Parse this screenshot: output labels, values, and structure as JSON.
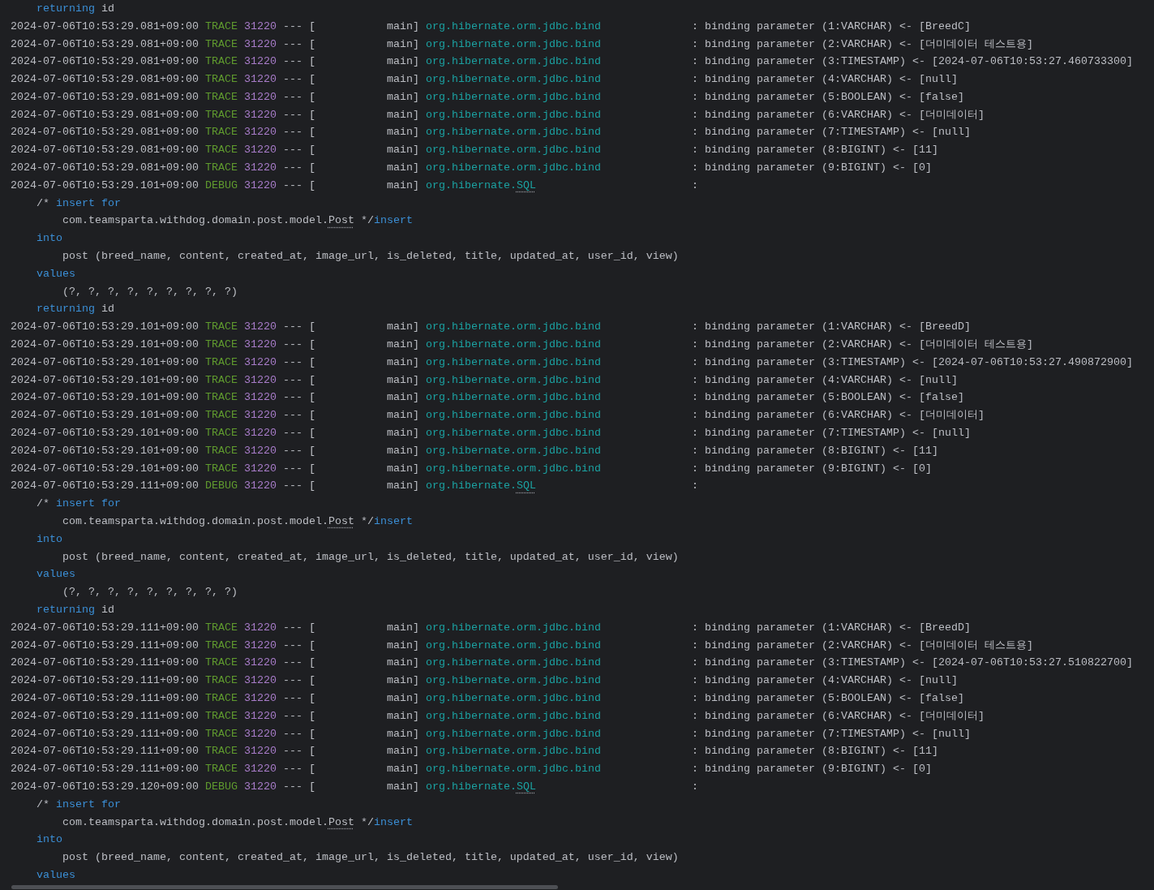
{
  "console": {
    "lines": [
      {
        "kind": "sql",
        "clauses": [
          {
            "segments": [
              {
                "text": "returning",
                "kind": "keyword"
              },
              {
                "text": " id",
                "kind": "plain"
              }
            ]
          }
        ]
      },
      {
        "kind": "log",
        "timestamp": "2024-07-06T10:53:29.081+09:00",
        "level": "TRACE",
        "pid": "31220",
        "separator": "---",
        "bracket": "[",
        "thread": "main]",
        "logger": [
          {
            "text": "org.hibernate.orm.jdbc.bind",
            "marked": false
          }
        ],
        "colon": ":",
        "message": "binding parameter (1:VARCHAR) <- [BreedC]"
      },
      {
        "kind": "log",
        "timestamp": "2024-07-06T10:53:29.081+09:00",
        "level": "TRACE",
        "pid": "31220",
        "separator": "---",
        "bracket": "[",
        "thread": "main]",
        "logger": [
          {
            "text": "org.hibernate.orm.jdbc.bind",
            "marked": false
          }
        ],
        "colon": ":",
        "message": "binding parameter (2:VARCHAR) <- [더미데이터 테스트용]"
      },
      {
        "kind": "log",
        "timestamp": "2024-07-06T10:53:29.081+09:00",
        "level": "TRACE",
        "pid": "31220",
        "separator": "---",
        "bracket": "[",
        "thread": "main]",
        "logger": [
          {
            "text": "org.hibernate.orm.jdbc.bind",
            "marked": false
          }
        ],
        "colon": ":",
        "message": "binding parameter (3:TIMESTAMP) <- [2024-07-06T10:53:27.460733300]"
      },
      {
        "kind": "log",
        "timestamp": "2024-07-06T10:53:29.081+09:00",
        "level": "TRACE",
        "pid": "31220",
        "separator": "---",
        "bracket": "[",
        "thread": "main]",
        "logger": [
          {
            "text": "org.hibernate.orm.jdbc.bind",
            "marked": false
          }
        ],
        "colon": ":",
        "message": "binding parameter (4:VARCHAR) <- [null]"
      },
      {
        "kind": "log",
        "timestamp": "2024-07-06T10:53:29.081+09:00",
        "level": "TRACE",
        "pid": "31220",
        "separator": "---",
        "bracket": "[",
        "thread": "main]",
        "logger": [
          {
            "text": "org.hibernate.orm.jdbc.bind",
            "marked": false
          }
        ],
        "colon": ":",
        "message": "binding parameter (5:BOOLEAN) <- [false]"
      },
      {
        "kind": "log",
        "timestamp": "2024-07-06T10:53:29.081+09:00",
        "level": "TRACE",
        "pid": "31220",
        "separator": "---",
        "bracket": "[",
        "thread": "main]",
        "logger": [
          {
            "text": "org.hibernate.orm.jdbc.bind",
            "marked": false
          }
        ],
        "colon": ":",
        "message": "binding parameter (6:VARCHAR) <- [더미데이터]"
      },
      {
        "kind": "log",
        "timestamp": "2024-07-06T10:53:29.081+09:00",
        "level": "TRACE",
        "pid": "31220",
        "separator": "---",
        "bracket": "[",
        "thread": "main]",
        "logger": [
          {
            "text": "org.hibernate.orm.jdbc.bind",
            "marked": false
          }
        ],
        "colon": ":",
        "message": "binding parameter (7:TIMESTAMP) <- [null]"
      },
      {
        "kind": "log",
        "timestamp": "2024-07-06T10:53:29.081+09:00",
        "level": "TRACE",
        "pid": "31220",
        "separator": "---",
        "bracket": "[",
        "thread": "main]",
        "logger": [
          {
            "text": "org.hibernate.orm.jdbc.bind",
            "marked": false
          }
        ],
        "colon": ":",
        "message": "binding parameter (8:BIGINT) <- [11]"
      },
      {
        "kind": "log",
        "timestamp": "2024-07-06T10:53:29.081+09:00",
        "level": "TRACE",
        "pid": "31220",
        "separator": "---",
        "bracket": "[",
        "thread": "main]",
        "logger": [
          {
            "text": "org.hibernate.orm.jdbc.bind",
            "marked": false
          }
        ],
        "colon": ":",
        "message": "binding parameter (9:BIGINT) <- [0]"
      },
      {
        "kind": "log",
        "timestamp": "2024-07-06T10:53:29.101+09:00",
        "level": "DEBUG",
        "pid": "31220",
        "separator": "---",
        "bracket": "[",
        "thread": "main]",
        "logger": [
          {
            "text": "org.hibernate.",
            "marked": false
          },
          {
            "text": "SQL",
            "marked": true
          }
        ],
        "colon": ":"
      },
      {
        "kind": "sql",
        "clauses": [
          {
            "segments": [
              {
                "text": "/* ",
                "kind": "plain"
              },
              {
                "text": "insert for",
                "kind": "keyword"
              }
            ],
            "children": [
              {
                "segments": [
                  {
                    "text": "com.teamsparta.withdog.domain.post.model.",
                    "kind": "plain"
                  },
                  {
                    "text": "Post",
                    "kind": "plain",
                    "marked": true
                  },
                  {
                    "text": " */",
                    "kind": "plain"
                  },
                  {
                    "text": "insert",
                    "kind": "keyword"
                  }
                ]
              }
            ]
          },
          {
            "segments": [
              {
                "text": "into",
                "kind": "keyword"
              }
            ],
            "children": [
              {
                "segments": [
                  {
                    "text": "post (breed_name, content, created_at, image_url, is_deleted, title, updated_at, user_id, view)",
                    "kind": "plain"
                  }
                ]
              }
            ]
          },
          {
            "segments": [
              {
                "text": "values",
                "kind": "keyword"
              }
            ],
            "children": [
              {
                "segments": [
                  {
                    "text": "(?, ?, ?, ?, ?, ?, ?, ?, ?)",
                    "kind": "plain"
                  }
                ]
              }
            ]
          },
          {
            "segments": [
              {
                "text": "returning",
                "kind": "keyword"
              },
              {
                "text": " id",
                "kind": "plain"
              }
            ]
          }
        ]
      },
      {
        "kind": "log",
        "timestamp": "2024-07-06T10:53:29.101+09:00",
        "level": "TRACE",
        "pid": "31220",
        "separator": "---",
        "bracket": "[",
        "thread": "main]",
        "logger": [
          {
            "text": "org.hibernate.orm.jdbc.bind",
            "marked": false
          }
        ],
        "colon": ":",
        "message": "binding parameter (1:VARCHAR) <- [BreedD]"
      },
      {
        "kind": "log",
        "timestamp": "2024-07-06T10:53:29.101+09:00",
        "level": "TRACE",
        "pid": "31220",
        "separator": "---",
        "bracket": "[",
        "thread": "main]",
        "logger": [
          {
            "text": "org.hibernate.orm.jdbc.bind",
            "marked": false
          }
        ],
        "colon": ":",
        "message": "binding parameter (2:VARCHAR) <- [더미데이터 테스트용]"
      },
      {
        "kind": "log",
        "timestamp": "2024-07-06T10:53:29.101+09:00",
        "level": "TRACE",
        "pid": "31220",
        "separator": "---",
        "bracket": "[",
        "thread": "main]",
        "logger": [
          {
            "text": "org.hibernate.orm.jdbc.bind",
            "marked": false
          }
        ],
        "colon": ":",
        "message": "binding parameter (3:TIMESTAMP) <- [2024-07-06T10:53:27.490872900]"
      },
      {
        "kind": "log",
        "timestamp": "2024-07-06T10:53:29.101+09:00",
        "level": "TRACE",
        "pid": "31220",
        "separator": "---",
        "bracket": "[",
        "thread": "main]",
        "logger": [
          {
            "text": "org.hibernate.orm.jdbc.bind",
            "marked": false
          }
        ],
        "colon": ":",
        "message": "binding parameter (4:VARCHAR) <- [null]"
      },
      {
        "kind": "log",
        "timestamp": "2024-07-06T10:53:29.101+09:00",
        "level": "TRACE",
        "pid": "31220",
        "separator": "---",
        "bracket": "[",
        "thread": "main]",
        "logger": [
          {
            "text": "org.hibernate.orm.jdbc.bind",
            "marked": false
          }
        ],
        "colon": ":",
        "message": "binding parameter (5:BOOLEAN) <- [false]"
      },
      {
        "kind": "log",
        "timestamp": "2024-07-06T10:53:29.101+09:00",
        "level": "TRACE",
        "pid": "31220",
        "separator": "---",
        "bracket": "[",
        "thread": "main]",
        "logger": [
          {
            "text": "org.hibernate.orm.jdbc.bind",
            "marked": false
          }
        ],
        "colon": ":",
        "message": "binding parameter (6:VARCHAR) <- [더미데이터]"
      },
      {
        "kind": "log",
        "timestamp": "2024-07-06T10:53:29.101+09:00",
        "level": "TRACE",
        "pid": "31220",
        "separator": "---",
        "bracket": "[",
        "thread": "main]",
        "logger": [
          {
            "text": "org.hibernate.orm.jdbc.bind",
            "marked": false
          }
        ],
        "colon": ":",
        "message": "binding parameter (7:TIMESTAMP) <- [null]"
      },
      {
        "kind": "log",
        "timestamp": "2024-07-06T10:53:29.101+09:00",
        "level": "TRACE",
        "pid": "31220",
        "separator": "---",
        "bracket": "[",
        "thread": "main]",
        "logger": [
          {
            "text": "org.hibernate.orm.jdbc.bind",
            "marked": false
          }
        ],
        "colon": ":",
        "message": "binding parameter (8:BIGINT) <- [11]"
      },
      {
        "kind": "log",
        "timestamp": "2024-07-06T10:53:29.101+09:00",
        "level": "TRACE",
        "pid": "31220",
        "separator": "---",
        "bracket": "[",
        "thread": "main]",
        "logger": [
          {
            "text": "org.hibernate.orm.jdbc.bind",
            "marked": false
          }
        ],
        "colon": ":",
        "message": "binding parameter (9:BIGINT) <- [0]"
      },
      {
        "kind": "log",
        "timestamp": "2024-07-06T10:53:29.111+09:00",
        "level": "DEBUG",
        "pid": "31220",
        "separator": "---",
        "bracket": "[",
        "thread": "main]",
        "logger": [
          {
            "text": "org.hibernate.",
            "marked": false
          },
          {
            "text": "SQL",
            "marked": true
          }
        ],
        "colon": ":"
      },
      {
        "kind": "sql",
        "clauses": [
          {
            "segments": [
              {
                "text": "/* ",
                "kind": "plain"
              },
              {
                "text": "insert for",
                "kind": "keyword"
              }
            ],
            "children": [
              {
                "segments": [
                  {
                    "text": "com.teamsparta.withdog.domain.post.model.",
                    "kind": "plain"
                  },
                  {
                    "text": "Post",
                    "kind": "plain",
                    "marked": true
                  },
                  {
                    "text": " */",
                    "kind": "plain"
                  },
                  {
                    "text": "insert",
                    "kind": "keyword"
                  }
                ]
              }
            ]
          },
          {
            "segments": [
              {
                "text": "into",
                "kind": "keyword"
              }
            ],
            "children": [
              {
                "segments": [
                  {
                    "text": "post (breed_name, content, created_at, image_url, is_deleted, title, updated_at, user_id, view)",
                    "kind": "plain"
                  }
                ]
              }
            ]
          },
          {
            "segments": [
              {
                "text": "values",
                "kind": "keyword"
              }
            ],
            "children": [
              {
                "segments": [
                  {
                    "text": "(?, ?, ?, ?, ?, ?, ?, ?, ?)",
                    "kind": "plain"
                  }
                ]
              }
            ]
          },
          {
            "segments": [
              {
                "text": "returning",
                "kind": "keyword"
              },
              {
                "text": " id",
                "kind": "plain"
              }
            ]
          }
        ]
      },
      {
        "kind": "log",
        "timestamp": "2024-07-06T10:53:29.111+09:00",
        "level": "TRACE",
        "pid": "31220",
        "separator": "---",
        "bracket": "[",
        "thread": "main]",
        "logger": [
          {
            "text": "org.hibernate.orm.jdbc.bind",
            "marked": false
          }
        ],
        "colon": ":",
        "message": "binding parameter (1:VARCHAR) <- [BreedD]"
      },
      {
        "kind": "log",
        "timestamp": "2024-07-06T10:53:29.111+09:00",
        "level": "TRACE",
        "pid": "31220",
        "separator": "---",
        "bracket": "[",
        "thread": "main]",
        "logger": [
          {
            "text": "org.hibernate.orm.jdbc.bind",
            "marked": false
          }
        ],
        "colon": ":",
        "message": "binding parameter (2:VARCHAR) <- [더미데이터 테스트용]"
      },
      {
        "kind": "log",
        "timestamp": "2024-07-06T10:53:29.111+09:00",
        "level": "TRACE",
        "pid": "31220",
        "separator": "---",
        "bracket": "[",
        "thread": "main]",
        "logger": [
          {
            "text": "org.hibernate.orm.jdbc.bind",
            "marked": false
          }
        ],
        "colon": ":",
        "message": "binding parameter (3:TIMESTAMP) <- [2024-07-06T10:53:27.510822700]"
      },
      {
        "kind": "log",
        "timestamp": "2024-07-06T10:53:29.111+09:00",
        "level": "TRACE",
        "pid": "31220",
        "separator": "---",
        "bracket": "[",
        "thread": "main]",
        "logger": [
          {
            "text": "org.hibernate.orm.jdbc.bind",
            "marked": false
          }
        ],
        "colon": ":",
        "message": "binding parameter (4:VARCHAR) <- [null]"
      },
      {
        "kind": "log",
        "timestamp": "2024-07-06T10:53:29.111+09:00",
        "level": "TRACE",
        "pid": "31220",
        "separator": "---",
        "bracket": "[",
        "thread": "main]",
        "logger": [
          {
            "text": "org.hibernate.orm.jdbc.bind",
            "marked": false
          }
        ],
        "colon": ":",
        "message": "binding parameter (5:BOOLEAN) <- [false]"
      },
      {
        "kind": "log",
        "timestamp": "2024-07-06T10:53:29.111+09:00",
        "level": "TRACE",
        "pid": "31220",
        "separator": "---",
        "bracket": "[",
        "thread": "main]",
        "logger": [
          {
            "text": "org.hibernate.orm.jdbc.bind",
            "marked": false
          }
        ],
        "colon": ":",
        "message": "binding parameter (6:VARCHAR) <- [더미데이터]"
      },
      {
        "kind": "log",
        "timestamp": "2024-07-06T10:53:29.111+09:00",
        "level": "TRACE",
        "pid": "31220",
        "separator": "---",
        "bracket": "[",
        "thread": "main]",
        "logger": [
          {
            "text": "org.hibernate.orm.jdbc.bind",
            "marked": false
          }
        ],
        "colon": ":",
        "message": "binding parameter (7:TIMESTAMP) <- [null]"
      },
      {
        "kind": "log",
        "timestamp": "2024-07-06T10:53:29.111+09:00",
        "level": "TRACE",
        "pid": "31220",
        "separator": "---",
        "bracket": "[",
        "thread": "main]",
        "logger": [
          {
            "text": "org.hibernate.orm.jdbc.bind",
            "marked": false
          }
        ],
        "colon": ":",
        "message": "binding parameter (8:BIGINT) <- [11]"
      },
      {
        "kind": "log",
        "timestamp": "2024-07-06T10:53:29.111+09:00",
        "level": "TRACE",
        "pid": "31220",
        "separator": "---",
        "bracket": "[",
        "thread": "main]",
        "logger": [
          {
            "text": "org.hibernate.orm.jdbc.bind",
            "marked": false
          }
        ],
        "colon": ":",
        "message": "binding parameter (9:BIGINT) <- [0]"
      },
      {
        "kind": "log",
        "timestamp": "2024-07-06T10:53:29.120+09:00",
        "level": "DEBUG",
        "pid": "31220",
        "separator": "---",
        "bracket": "[",
        "thread": "main]",
        "logger": [
          {
            "text": "org.hibernate.",
            "marked": false
          },
          {
            "text": "SQL",
            "marked": true
          }
        ],
        "colon": ":"
      },
      {
        "kind": "sql",
        "clauses": [
          {
            "segments": [
              {
                "text": "/* ",
                "kind": "plain"
              },
              {
                "text": "insert for",
                "kind": "keyword"
              }
            ],
            "children": [
              {
                "segments": [
                  {
                    "text": "com.teamsparta.withdog.domain.post.model.",
                    "kind": "plain"
                  },
                  {
                    "text": "Post",
                    "kind": "plain",
                    "marked": true
                  },
                  {
                    "text": " */",
                    "kind": "plain"
                  },
                  {
                    "text": "insert",
                    "kind": "keyword"
                  }
                ]
              }
            ]
          },
          {
            "segments": [
              {
                "text": "into",
                "kind": "keyword"
              }
            ],
            "children": [
              {
                "segments": [
                  {
                    "text": "post (breed_name, content, created_at, image_url, is_deleted, title, updated_at, user_id, view)",
                    "kind": "plain"
                  }
                ]
              }
            ]
          },
          {
            "segments": [
              {
                "text": "values",
                "kind": "keyword"
              }
            ]
          }
        ]
      }
    ]
  }
}
